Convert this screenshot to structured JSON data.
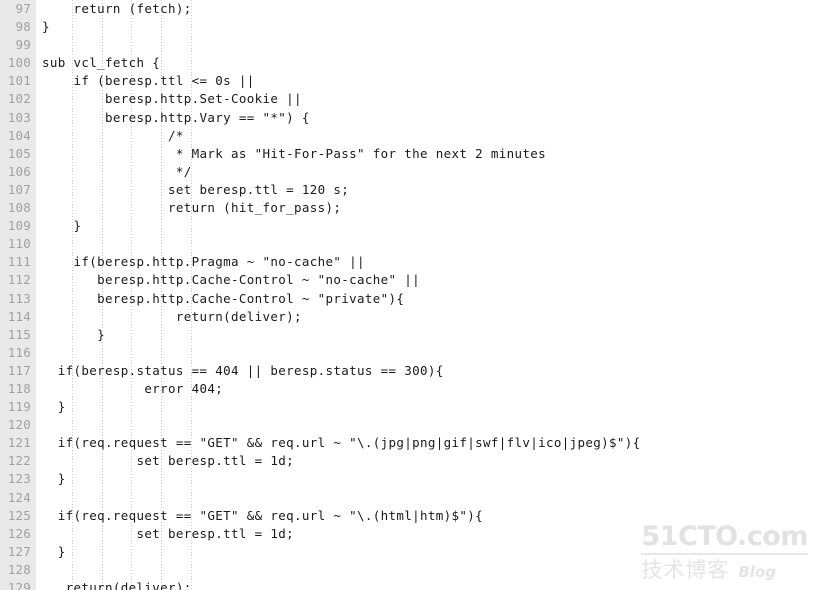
{
  "editor": {
    "language": "vcl",
    "gutter_bg": "#e9e9e9",
    "line_number_color": "#a0a0a0",
    "code_color": "#1a1a1a",
    "background": "#ffffff",
    "indent_guide_color": "#cccccc",
    "first_line_number": 97,
    "last_line_number": 129,
    "lines": [
      {
        "num": "97",
        "text": "    return (fetch);"
      },
      {
        "num": "98",
        "text": "}"
      },
      {
        "num": "99",
        "text": ""
      },
      {
        "num": "100",
        "text": "sub vcl_fetch {"
      },
      {
        "num": "101",
        "text": "    if (beresp.ttl <= 0s ||"
      },
      {
        "num": "102",
        "text": "        beresp.http.Set-Cookie ||"
      },
      {
        "num": "103",
        "text": "        beresp.http.Vary == \"*\") {"
      },
      {
        "num": "104",
        "text": "                /*"
      },
      {
        "num": "105",
        "text": "                 * Mark as \"Hit-For-Pass\" for the next 2 minutes"
      },
      {
        "num": "106",
        "text": "                 */"
      },
      {
        "num": "107",
        "text": "                set beresp.ttl = 120 s;"
      },
      {
        "num": "108",
        "text": "                return (hit_for_pass);"
      },
      {
        "num": "109",
        "text": "    }"
      },
      {
        "num": "110",
        "text": ""
      },
      {
        "num": "111",
        "text": "    if(beresp.http.Pragma ~ \"no-cache\" ||"
      },
      {
        "num": "112",
        "text": "       beresp.http.Cache-Control ~ \"no-cache\" ||"
      },
      {
        "num": "113",
        "text": "       beresp.http.Cache-Control ~ \"private\"){"
      },
      {
        "num": "114",
        "text": "                 return(deliver);"
      },
      {
        "num": "115",
        "text": "       }"
      },
      {
        "num": "116",
        "text": ""
      },
      {
        "num": "117",
        "text": "  if(beresp.status == 404 || beresp.status == 300){"
      },
      {
        "num": "118",
        "text": "             error 404;"
      },
      {
        "num": "119",
        "text": "  }"
      },
      {
        "num": "120",
        "text": ""
      },
      {
        "num": "121",
        "text": "  if(req.request == \"GET\" && req.url ~ \"\\.(jpg|png|gif|swf|flv|ico|jpeg)$\"){"
      },
      {
        "num": "122",
        "text": "            set beresp.ttl = 1d;"
      },
      {
        "num": "123",
        "text": "  }"
      },
      {
        "num": "124",
        "text": ""
      },
      {
        "num": "125",
        "text": "  if(req.request == \"GET\" && req.url ~ \"\\.(html|htm)$\"){"
      },
      {
        "num": "126",
        "text": "            set beresp.ttl = 1d;"
      },
      {
        "num": "127",
        "text": "  }"
      },
      {
        "num": "128",
        "text": ""
      },
      {
        "num": "129",
        "text": "   return(deliver);"
      }
    ]
  },
  "watermark": {
    "main": "51CTO.com",
    "chinese": "技术博客",
    "blog": "Blog",
    "color": "#e3e3e3"
  }
}
